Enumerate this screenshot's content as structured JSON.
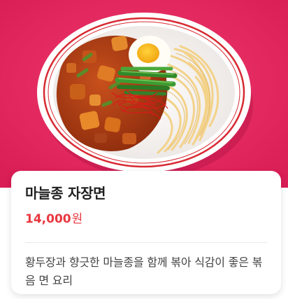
{
  "menu_item": {
    "name": "마늘종 자장면",
    "price": "14,000",
    "currency": "원",
    "description": "황두장과 향긋한 마늘종을 함께 볶아 식감이 좋은 볶음 면 요리",
    "image_alt": "마늘종 자장면"
  },
  "colors": {
    "background": "#e8265c",
    "price": "#e8373f",
    "bowl_rim": "#d82a33"
  }
}
